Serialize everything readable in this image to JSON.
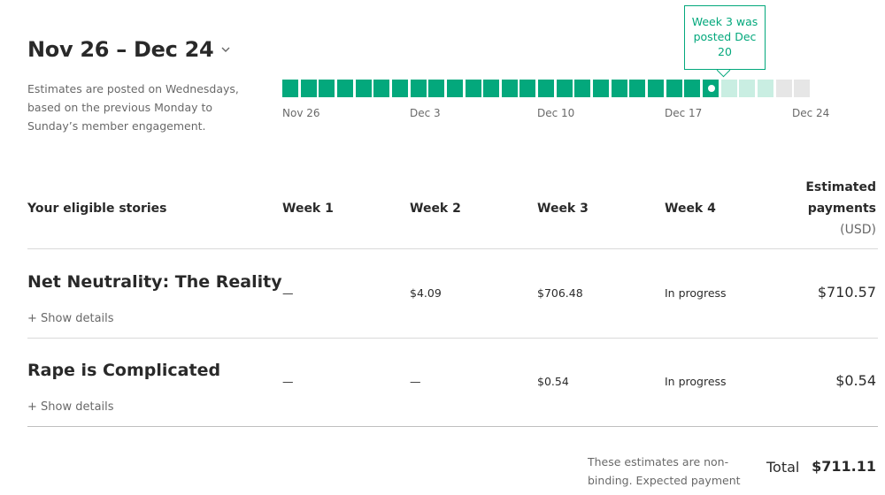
{
  "header": {
    "date_range": "Nov 26 – Dec 24",
    "note": "Estimates are posted on Wednesdays, based on the previous Monday to Sunday’s member engagement."
  },
  "timeline": {
    "ticks": [
      "Nov 26",
      "Dec 3",
      "Dec 10",
      "Dec 17",
      "Dec 24"
    ],
    "days_total": 29,
    "days_complete": 24,
    "days_in_progress": 3,
    "marker_day_index": 23,
    "tooltip": "Week 3 was posted Dec 20"
  },
  "table": {
    "headers": {
      "stories": "Your eligible stories",
      "week1": "Week 1",
      "week2": "Week 2",
      "week3": "Week 3",
      "week4": "Week 4",
      "payments_line1": "Estimated",
      "payments_line2": "payments",
      "payments_line3": "(USD)"
    },
    "rows": [
      {
        "title": "Net Neutrality: The Reality",
        "details": "+ Show details",
        "week1": "—",
        "week2": "$4.09",
        "week3": "$706.48",
        "week4": "In progress",
        "total": "$710.57"
      },
      {
        "title": "Rape is Complicated",
        "details": "+ Show details",
        "week1": "—",
        "week2": "—",
        "week3": "$0.54",
        "week4": "In progress",
        "total": "$0.54"
      }
    ]
  },
  "footer": {
    "note": "These estimates are non-binding. Expected payment",
    "total_label": "Total",
    "total_value": "$711.11"
  },
  "colors": {
    "complete": "#03a87c",
    "in_progress": "#c9eee2",
    "future": "#e6e6e6",
    "accent": "#03a87c"
  }
}
